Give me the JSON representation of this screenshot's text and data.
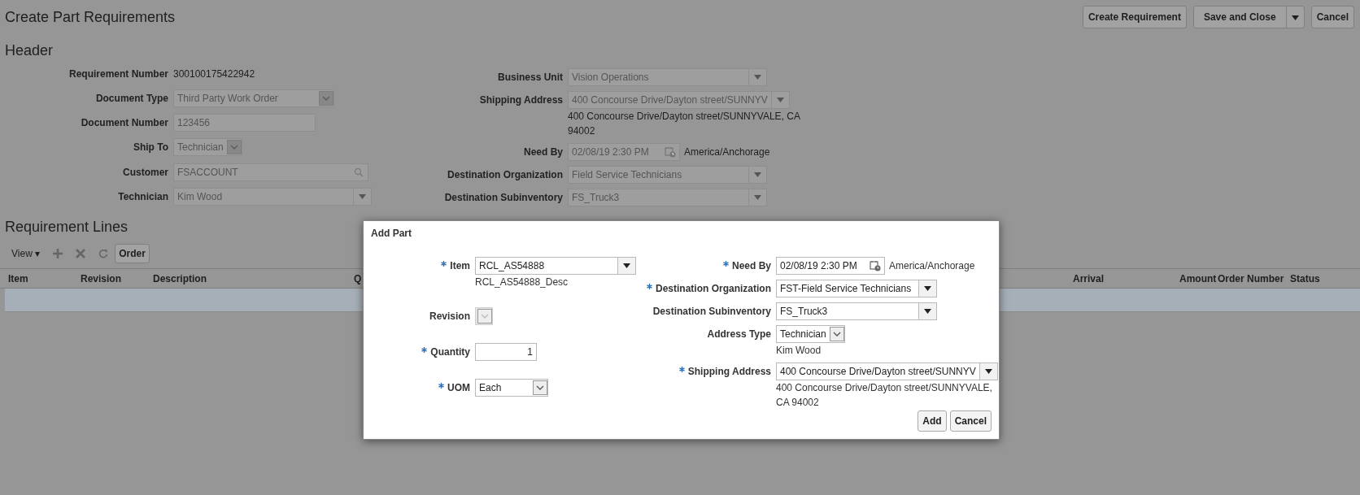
{
  "page": {
    "title": "Create Part Requirements",
    "buttons": [
      {
        "label": "Create Requirement",
        "kind": "plain"
      },
      {
        "label": "Save and Close",
        "kind": "split"
      },
      {
        "label": "Cancel",
        "kind": "plain"
      }
    ]
  },
  "header": {
    "title": "Header",
    "left_fields": [
      {
        "label": "Requirement Number",
        "kind": "readonly",
        "value": "300100175422942"
      },
      {
        "label": "Document Type",
        "kind": "choice",
        "value": "Third Party Work Order"
      },
      {
        "label": "Document Number",
        "kind": "input",
        "value": "123456"
      },
      {
        "label": "Ship To",
        "kind": "choice",
        "value": "Technician"
      },
      {
        "label": "Customer",
        "kind": "search",
        "value": "FSACCOUNT"
      },
      {
        "label": "Technician",
        "kind": "list",
        "value": "Kim Wood"
      }
    ],
    "right_fields": [
      {
        "label": "Business Unit",
        "kind": "list",
        "value": "Vision Operations"
      },
      {
        "label": "Shipping Address",
        "kind": "list",
        "value": "400 Concourse Drive/Dayton street/SUNNYV",
        "note": "400 Concourse Drive/Dayton street/SUNNYVALE, CA 94002"
      },
      {
        "label": "Need By",
        "kind": "date",
        "value": "02/08/19 2:30 PM",
        "suffix": "America/Anchorage"
      },
      {
        "label": "Destination Organization",
        "kind": "list",
        "value": "Field Service Technicians"
      },
      {
        "label": "Destination Subinventory",
        "kind": "list",
        "value": "FS_Truck3"
      }
    ]
  },
  "requirement_lines": {
    "title": "Requirement Lines",
    "view_menu": "View ▾",
    "toolbar_button": "Order",
    "columns": [
      "Item",
      "Revision",
      "Description",
      "Q",
      "Arrival",
      "Amount",
      "Order Number",
      "Status"
    ]
  },
  "dialog": {
    "title": "Add Part",
    "left_fields": [
      {
        "label": "Item",
        "kind": "list",
        "required": true,
        "disabled": false,
        "value": "RCL_AS54888",
        "note": "RCL_AS54888_Desc"
      },
      {
        "label": "Revision",
        "kind": "choice",
        "required": false,
        "disabled": true
      },
      {
        "label": "Quantity",
        "kind": "number",
        "required": true,
        "disabled": false,
        "value": "1"
      },
      {
        "label": "UOM",
        "kind": "choice",
        "required": true,
        "disabled": false,
        "value": "Each"
      }
    ],
    "right_fields": [
      {
        "label": "Need By",
        "kind": "date",
        "required": true,
        "disabled": false,
        "value": "02/08/19 2:30 PM",
        "suffix": "America/Anchorage"
      },
      {
        "label": "Destination Organization",
        "kind": "list",
        "required": true,
        "disabled": false,
        "value": "FST-Field Service Technicians"
      },
      {
        "label": "Destination Subinventory",
        "kind": "list",
        "required": false,
        "disabled": false,
        "value": "FS_Truck3"
      },
      {
        "label": "Address Type",
        "kind": "choice",
        "required": false,
        "disabled": false,
        "value": "Technician",
        "note": "Kim Wood"
      },
      {
        "label": "Shipping Address",
        "kind": "list",
        "required": true,
        "disabled": false,
        "value": "400 Concourse Drive/Dayton street/SUNNYV",
        "note": "400 Concourse Drive/Dayton street/SUNNYVALE, CA 94002"
      }
    ],
    "buttons": [
      "Add",
      "Cancel"
    ]
  }
}
